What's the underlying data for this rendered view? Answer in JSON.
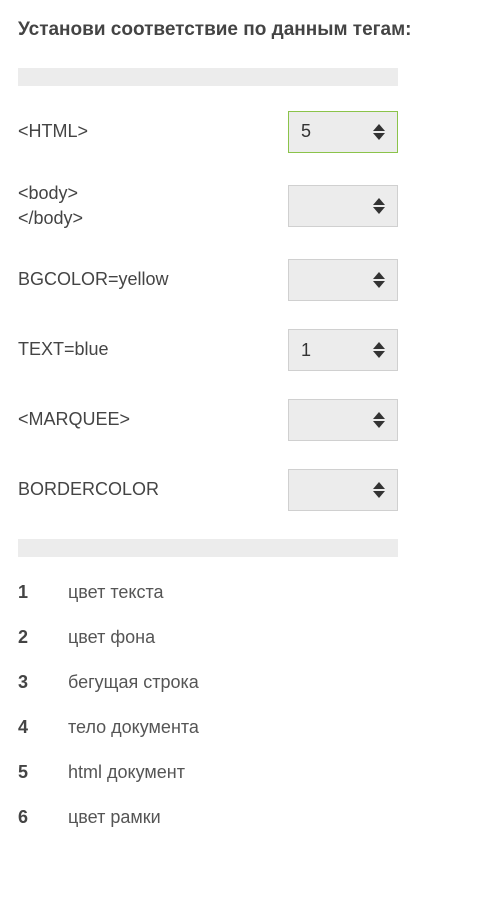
{
  "title": "Установи соответствие по данным тегам:",
  "matches": [
    {
      "label": "<HTML>",
      "value": "5",
      "active": true
    },
    {
      "label": "<body>\n</body>",
      "value": "",
      "active": false
    },
    {
      "label": "BGCOLOR=yellow",
      "value": "",
      "active": false
    },
    {
      "label": "TEXT=blue",
      "value": "1",
      "active": false
    },
    {
      "label": "<MARQUEE>",
      "value": "",
      "active": false
    },
    {
      "label": "BORDERCOLOR",
      "value": "",
      "active": false
    }
  ],
  "answers": [
    {
      "num": "1",
      "text": "цвет текста"
    },
    {
      "num": "2",
      "text": "цвет фона"
    },
    {
      "num": "3",
      "text": "бегущая строка"
    },
    {
      "num": "4",
      "text": "тело документа"
    },
    {
      "num": "5",
      "text": "html документ"
    },
    {
      "num": "6",
      "text": "цвет рамки"
    }
  ]
}
